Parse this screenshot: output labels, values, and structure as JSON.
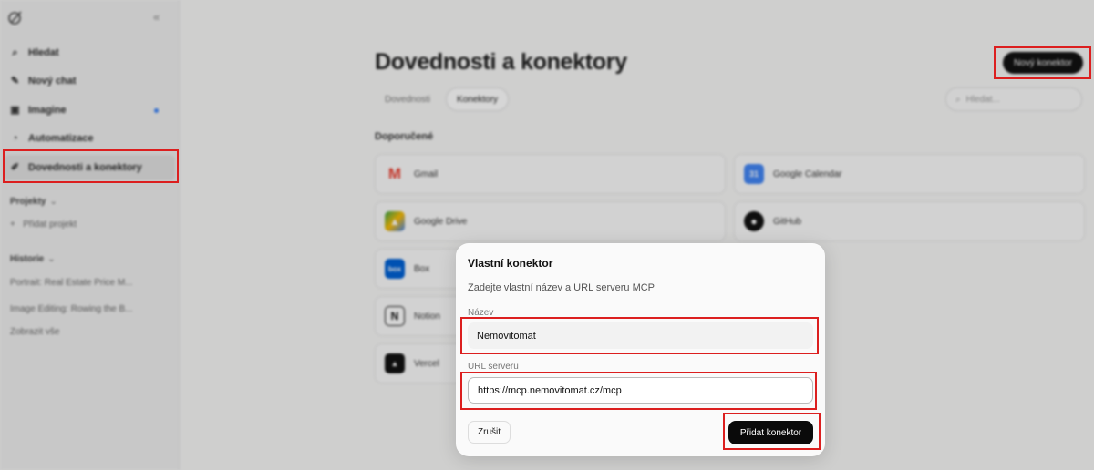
{
  "sidebar": {
    "logo_icon": "knot-logo-icon",
    "collapse_icon": "double-chevron-left-icon",
    "items": [
      {
        "label": "Hledat",
        "icon": "search-icon"
      },
      {
        "label": "Nový chat",
        "icon": "edit-icon"
      },
      {
        "label": "Imagine",
        "icon": "image-icon",
        "badge_color": "#3b82f6"
      },
      {
        "label": "Automatizace",
        "icon": "clock-icon"
      },
      {
        "label": "Dovednosti a konektory",
        "icon": "puzzle-icon",
        "active": true
      }
    ],
    "projects_label": "Projekty",
    "add_project": "Přidat projekt",
    "history_label": "Historie",
    "history_items": [
      "Portrait: Real Estate Price M...",
      "Image Editing: Rowing the B..."
    ],
    "show_all": "Zobrazit vše"
  },
  "main": {
    "title": "Dovednosti a konektory",
    "new_connector_button": "Nový konektor",
    "tabs": [
      {
        "label": "Dovednosti"
      },
      {
        "label": "Konektory",
        "active": true
      }
    ],
    "search_placeholder": "Hledat...",
    "recommended_label": "Doporučené",
    "connectors": [
      {
        "name": "Gmail",
        "icon": "gmail-icon",
        "color": "#ea4335"
      },
      {
        "name": "Google Calendar",
        "icon": "google-calendar-icon",
        "color": "#4285f4"
      },
      {
        "name": "Google Drive",
        "icon": "google-drive-icon",
        "color": "#34a853"
      },
      {
        "name": "GitHub",
        "icon": "github-icon",
        "color": "#111111"
      },
      {
        "name": "Box",
        "icon": "box-icon",
        "color": "#0061d5"
      },
      {
        "name": "Notion",
        "icon": "notion-icon",
        "color": "#111111"
      },
      {
        "name": "Vercel",
        "icon": "vercel-icon",
        "color": "#111111"
      }
    ]
  },
  "modal": {
    "title": "Vlastní konektor",
    "description": "Zadejte vlastní název a URL serveru MCP",
    "name_label": "Název",
    "name_value": "Nemovitomat",
    "url_label": "URL serveru",
    "url_value": "https://mcp.nemovitomat.cz/mcp",
    "cancel_button": "Zrušit",
    "submit_button": "Přidat konektor"
  },
  "colors": {
    "highlight": "#dc1f1f",
    "primary_button": "#0a0a0a",
    "background": "#f7f7f6"
  }
}
